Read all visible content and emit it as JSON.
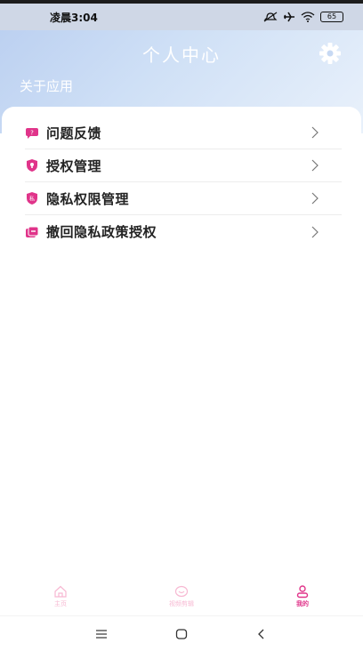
{
  "status_bar": {
    "time": "凌晨3:04",
    "battery": "65",
    "icons": [
      "mute-icon",
      "airplane-icon",
      "wifi-icon",
      "battery-icon"
    ]
  },
  "header": {
    "title": "个人中心",
    "subtitle": "关于应用",
    "settings_icon": "gear-icon"
  },
  "menu": {
    "items": [
      {
        "label": "问题反馈",
        "icon": "feedback-icon"
      },
      {
        "label": "授权管理",
        "icon": "authorization-icon"
      },
      {
        "label": "隐私权限管理",
        "icon": "privacy-icon"
      },
      {
        "label": "撤回隐私政策授权",
        "icon": "revoke-icon"
      }
    ]
  },
  "tab_bar": {
    "tabs": [
      {
        "label": "主页",
        "icon": "home-icon",
        "active": false
      },
      {
        "label": "视频剪辑",
        "icon": "video-edit-icon",
        "active": false
      },
      {
        "label": "我的",
        "icon": "profile-icon",
        "active": true
      }
    ]
  },
  "colors": {
    "accent": "#e0348a",
    "header_gradient_start": "#b9cef0",
    "header_gradient_end": "#e9f1fb"
  }
}
